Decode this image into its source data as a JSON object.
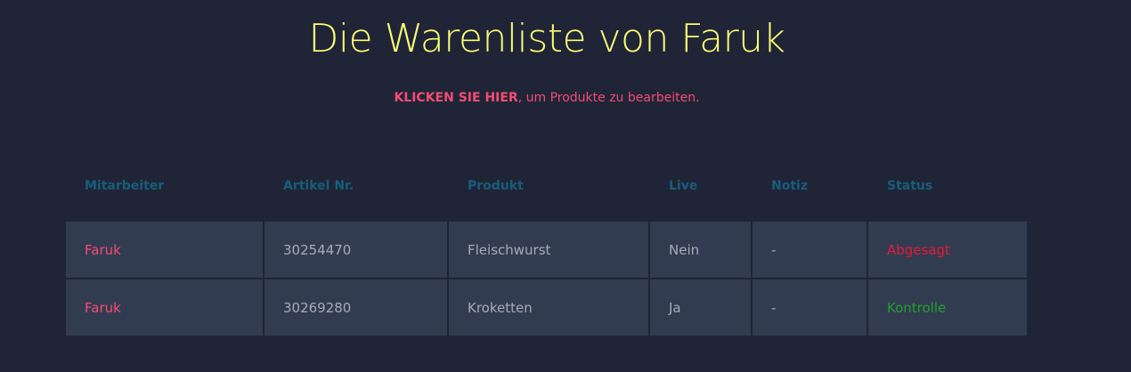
{
  "header": {
    "title": "Die Warenliste von Faruk",
    "subtitle_link": "KLICKEN SIE HIER",
    "subtitle_rest": ", um Produkte zu bearbeiten."
  },
  "table": {
    "columns": [
      "Mitarbeiter",
      "Artikel Nr.",
      "Produkt",
      "Live",
      "Notiz",
      "Status"
    ],
    "rows": [
      {
        "mitarbeiter": "Faruk",
        "artikel_nr": "30254470",
        "produkt": "Fleischwurst",
        "live": "Nein",
        "notiz": "-",
        "status": "Abgesagt"
      },
      {
        "mitarbeiter": "Faruk",
        "artikel_nr": "30269280",
        "produkt": "Kroketten",
        "live": "Ja",
        "notiz": "-",
        "status": "Kontrolle"
      }
    ]
  },
  "colors": {
    "background": "#1f2536",
    "title": "#fbfb75",
    "accent": "#f54b73",
    "header_text": "#185d7a",
    "cell_background": "#323c50",
    "status_cancelled": "#e9183a",
    "status_control": "#1fa12b"
  }
}
